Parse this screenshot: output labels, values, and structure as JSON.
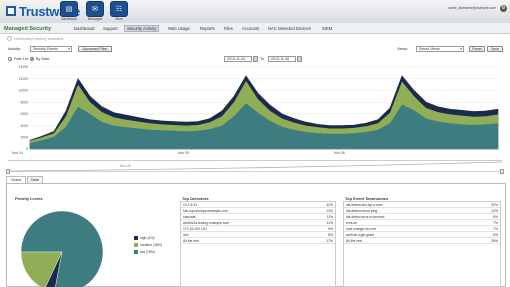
{
  "header": {
    "logo_text": "Trustwave",
    "buttons": [
      {
        "label": "Dashboard",
        "icon": "dashboard-icon"
      },
      {
        "label": "Messages",
        "icon": "messages-icon"
      },
      {
        "label": "Store",
        "icon": "store-icon"
      }
    ],
    "user": "name_lastname@example.com"
  },
  "nav": {
    "product": "Managed Security",
    "items": [
      "Dashboard",
      "Support",
      "Security Activity",
      "Web Usage",
      "Reports",
      "Files",
      "Accounts",
      "NAC Detected Devices",
      "SIEM"
    ],
    "active": "Security Activity"
  },
  "notification": "Notification history available",
  "filters": {
    "activity_label": "Activity:",
    "activity_value": "Security Events",
    "advanced_filter": "Advanced Filter",
    "views_label": "Views:",
    "views_value": "Saved Views",
    "reset": "Reset",
    "save": "Save",
    "radio_past": "Past 1hr",
    "radio_date": "By Date",
    "date_from": "2013-11-04",
    "to_label": "To",
    "date_to": "2013-11-06"
  },
  "chart_data": {
    "type": "area",
    "x_ticks": [
      "Nov 04",
      "Nov 05",
      "Nov 06"
    ],
    "y_ticks": [
      "0",
      "2000",
      "4000",
      "6000",
      "8000",
      "10000",
      "12000",
      "14000"
    ],
    "ylim": [
      0,
      14000
    ],
    "series": [
      {
        "values": [
          1500,
          2200,
          3000,
          6500,
          12000,
          9000,
          7200,
          6200,
          5800,
          5400,
          5000,
          4800,
          4700,
          4600,
          4700,
          5200,
          6500,
          9000,
          12500,
          9500,
          7500,
          6000,
          5200,
          4600,
          4200,
          4000,
          4000,
          4100,
          4400,
          5000,
          7000,
          12500,
          10000,
          8000,
          7200,
          6800,
          6600,
          6400,
          6500,
          6800
        ]
      },
      {
        "values": [
          1400,
          2000,
          2700,
          5600,
          11000,
          8000,
          6300,
          5400,
          5000,
          4700,
          4400,
          4200,
          4100,
          4000,
          4100,
          4600,
          5600,
          8000,
          11600,
          8500,
          6500,
          5200,
          4500,
          4000,
          3700,
          3500,
          3500,
          3600,
          3900,
          4400,
          6200,
          11500,
          9000,
          7000,
          6300,
          5900,
          5700,
          5500,
          5600,
          5900
        ]
      },
      {
        "values": [
          1000,
          1500,
          2100,
          3800,
          7200,
          6000,
          4600,
          4000,
          3700,
          3500,
          3300,
          3200,
          3100,
          3000,
          3100,
          3400,
          4000,
          5600,
          7800,
          6200,
          4800,
          3800,
          3300,
          2900,
          2700,
          2600,
          2600,
          2700,
          2900,
          3300,
          4400,
          7600,
          6600,
          5200,
          4700,
          4400,
          4200,
          4100,
          4200,
          4400
        ]
      }
    ],
    "colors": [
      "#1c2a4d",
      "#8fae55",
      "#3d7c80"
    ],
    "grid": true
  },
  "slider": {
    "handle": "Nov 05"
  },
  "tabs": [
    "Charts",
    "Table"
  ],
  "priority": {
    "title": "Priority Levels",
    "slices": [
      {
        "name": "high (4%)",
        "value": 4,
        "color": "#1c2a4d"
      },
      {
        "name": "medium (18%)",
        "value": 18,
        "color": "#8fae55"
      },
      {
        "name": "low (78%)",
        "value": 78,
        "color": "#3d7c80"
      }
    ]
  },
  "detectors": {
    "title": "Top Detectors",
    "rows": [
      [
        "10.1.5.41",
        "32%"
      ],
      [
        "ssh-tcpcsvctrpa.example.com",
        "12%"
      ],
      [
        "cascade",
        "11%"
      ],
      [
        "ars5d12a.testing.example.com",
        "11%"
      ],
      [
        "172.16.100.100",
        "9%"
      ],
      [
        "dns",
        "8%"
      ],
      [
        "All the rest",
        "17%"
      ]
    ]
  },
  "taxonomies": {
    "title": "Top Event Taxonomies",
    "rows": [
      [
        "ids.detect.dns.tcp.e.user",
        "32%"
      ],
      [
        "ids.detect.recon.ping",
        "12%"
      ],
      [
        "ids.detect.error.w.connect",
        "8%"
      ],
      [
        "ems.av",
        "7%"
      ],
      [
        "ossf.change.fw.conf",
        "7%"
      ],
      [
        "auth.db.login.grant",
        "6%"
      ],
      [
        "All the rest",
        "28%"
      ]
    ]
  }
}
